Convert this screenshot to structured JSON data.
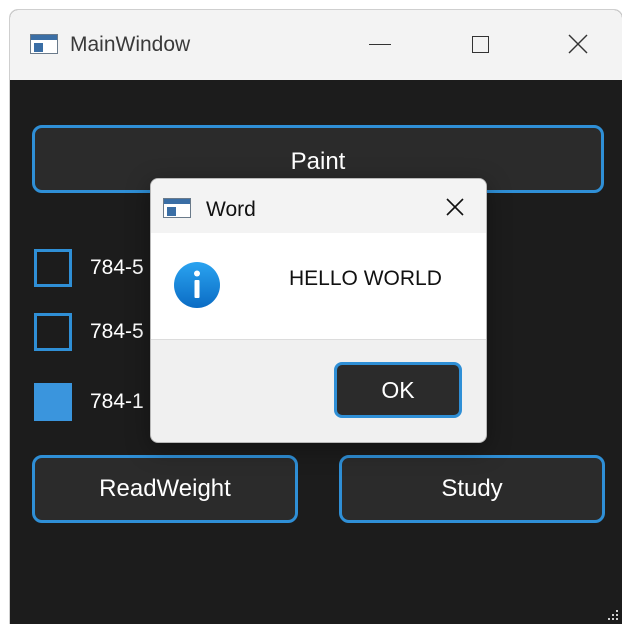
{
  "window": {
    "title": "MainWindow",
    "controls": [
      "minimize",
      "maximize",
      "close"
    ]
  },
  "main": {
    "paint_button": "Paint",
    "checkboxes": [
      {
        "label": "784-5",
        "checked": false
      },
      {
        "label": "784-5",
        "checked": false
      },
      {
        "label": "784-1",
        "checked": true
      }
    ],
    "readweight_button": "ReadWeight",
    "study_button": "Study"
  },
  "dialog": {
    "title": "Word",
    "message": "HELLO WORLD",
    "icon": "info-icon",
    "ok_button": "OK"
  },
  "colors": {
    "accent": "#2f8fd6",
    "window_background": "#1c1c1c",
    "button_background": "#2b2b2b",
    "checked_fill": "#3a95dd",
    "titlebar": "#f3f3f3"
  }
}
